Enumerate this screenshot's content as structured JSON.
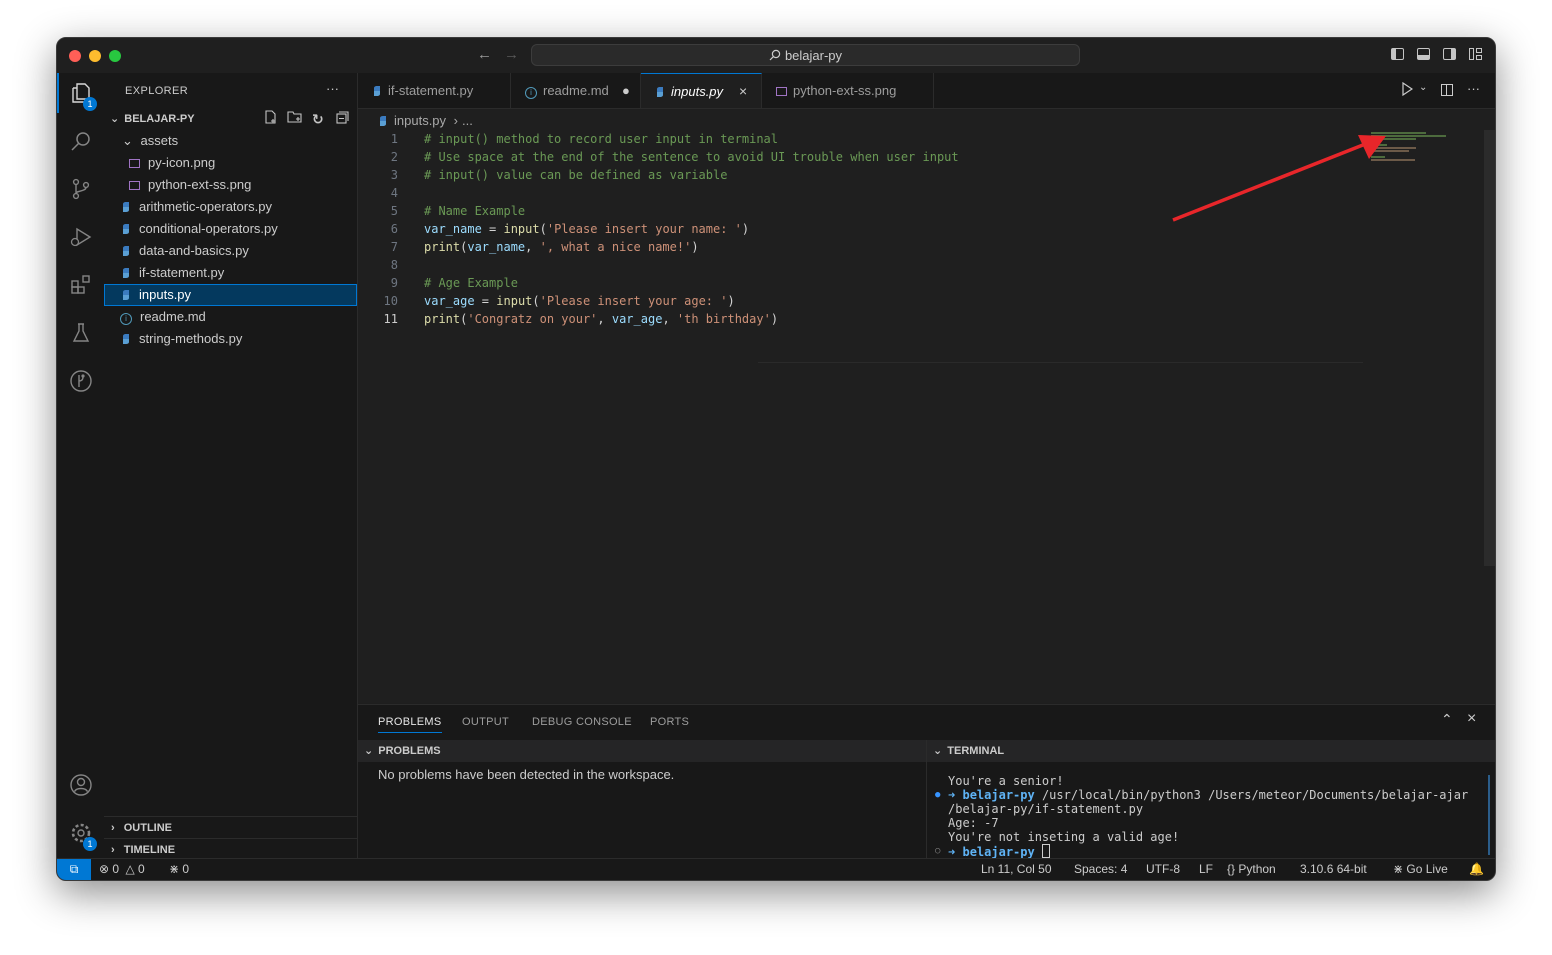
{
  "titlebar": {
    "search_text": "belajar-py"
  },
  "activity_bar": {
    "explorer_badge": "1",
    "settings_badge": "1"
  },
  "sidebar": {
    "title": "EXPLORER",
    "more": "···",
    "project": "BELAJAR-PY",
    "files": [
      {
        "label": "assets",
        "type": "folder"
      },
      {
        "label": "py-icon.png",
        "type": "image"
      },
      {
        "label": "python-ext-ss.png",
        "type": "image"
      },
      {
        "label": "arithmetic-operators.py",
        "type": "python"
      },
      {
        "label": "conditional-operators.py",
        "type": "python"
      },
      {
        "label": "data-and-basics.py",
        "type": "python"
      },
      {
        "label": "if-statement.py",
        "type": "python"
      },
      {
        "label": "inputs.py",
        "type": "python",
        "selected": true
      },
      {
        "label": "readme.md",
        "type": "info"
      },
      {
        "label": "string-methods.py",
        "type": "python"
      }
    ],
    "outline": "OUTLINE",
    "timeline": "TIMELINE"
  },
  "tabs": [
    {
      "label": "if-statement.py",
      "icon": "python-icon"
    },
    {
      "label": "readme.md",
      "icon": "info-icon",
      "dirty": true
    },
    {
      "label": "inputs.py",
      "icon": "python-icon",
      "active": true
    },
    {
      "label": "python-ext-ss.png",
      "icon": "image-icon"
    }
  ],
  "breadcrumb": {
    "file": "inputs.py",
    "sep": "›",
    "rest": "..."
  },
  "editor": {
    "current_line": 11,
    "lines": [
      {
        "n": "1",
        "code": "# input() method to record user input in terminal"
      },
      {
        "n": "2",
        "code": "# Use space at the end of the sentence to avoid UI trouble when user input"
      },
      {
        "n": "3",
        "code": "# input() value can be defined as variable"
      },
      {
        "n": "4",
        "code": ""
      },
      {
        "n": "5",
        "code": "# Name Example"
      },
      {
        "n": "6",
        "code": "var_name = input('Please insert your name: ')"
      },
      {
        "n": "7",
        "code": "print(var_name, ', what a nice name!')"
      },
      {
        "n": "8",
        "code": ""
      },
      {
        "n": "9",
        "code": "# Age Example"
      },
      {
        "n": "10",
        "code": "var_age = input('Please insert your age: ')"
      },
      {
        "n": "11",
        "code": "print('Congratz on your', var_age, 'th birthday')"
      }
    ]
  },
  "panel": {
    "tabs": [
      "PROBLEMS",
      "OUTPUT",
      "DEBUG CONSOLE",
      "PORTS"
    ],
    "problems_header": "PROBLEMS",
    "problems_message": "No problems have been detected in the workspace.",
    "terminal_header": "TERMINAL",
    "terminal_lines": [
      {
        "prefix": "",
        "dir": "",
        "text": "You're a senior!"
      },
      {
        "prefix": "➜",
        "dir": "belajar-py",
        "text": " /usr/local/bin/python3 /Users/meteor/Documents/belajar-ajar"
      },
      {
        "prefix": "",
        "dir": "",
        "text": "/belajar-py/if-statement.py"
      },
      {
        "prefix": "",
        "dir": "",
        "text": "Age: -7"
      },
      {
        "prefix": "",
        "dir": "",
        "text": "You're not inseting a valid age!"
      },
      {
        "prefix": "➜",
        "dir": "belajar-py",
        "text": " "
      }
    ]
  },
  "statusbar": {
    "errors": "0",
    "warnings": "0",
    "ports": "0",
    "position": "Ln 11, Col 50",
    "spaces": "Spaces: 4",
    "encoding": "UTF-8",
    "eol": "LF",
    "language": "Python",
    "interpreter": "3.10.6 64-bit",
    "golive": "Go Live"
  },
  "colors": {
    "accent": "#0078d4",
    "annotation_arrow": "#e8262a",
    "selection": "#04395e"
  }
}
